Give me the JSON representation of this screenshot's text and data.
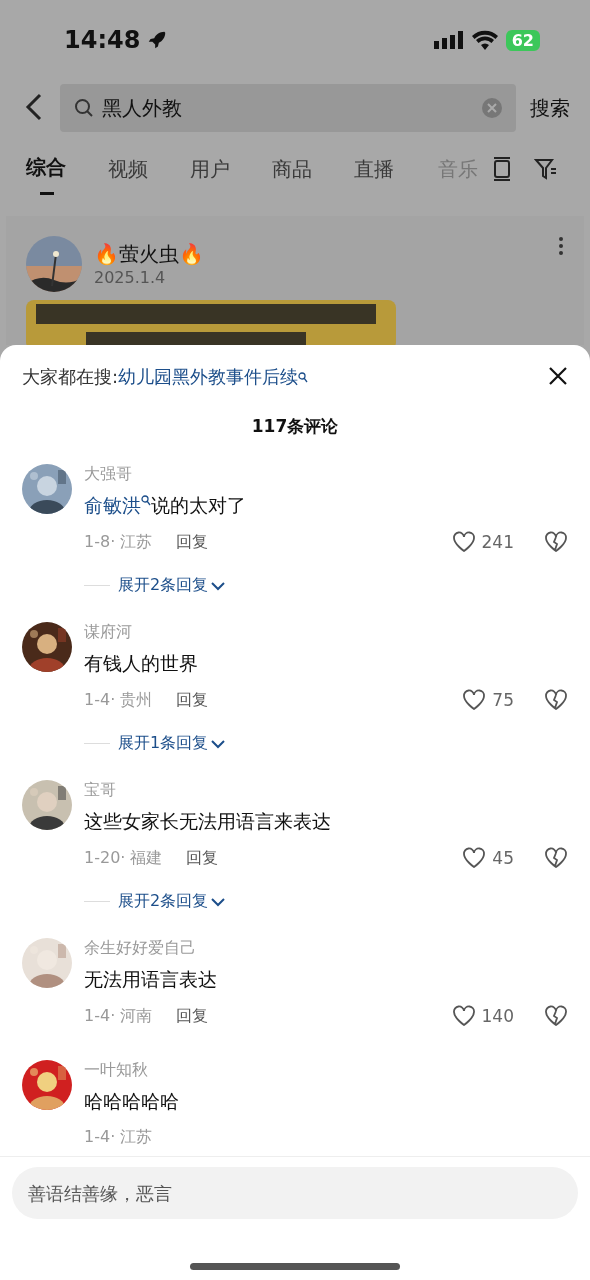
{
  "status_bar": {
    "time": "14:48",
    "battery": "62"
  },
  "search": {
    "query": "黑人外教",
    "button": "搜索"
  },
  "tabs": [
    {
      "label": "综合",
      "selected": true
    },
    {
      "label": "视频",
      "selected": false
    },
    {
      "label": "用户",
      "selected": false
    },
    {
      "label": "商品",
      "selected": false
    },
    {
      "label": "直播",
      "selected": false
    },
    {
      "label": "音乐",
      "selected": false
    }
  ],
  "post": {
    "author": "🔥萤火虫🔥",
    "date": "2025.1.4"
  },
  "comments_sheet": {
    "trending_label": "大家都在搜:",
    "trending_link": "幼儿园黑外教事件后续",
    "count": "117条评论",
    "comments": [
      {
        "user": "大强哥",
        "mention": "俞敏洪",
        "text": "说的太对了",
        "meta": "1-8· 江苏",
        "reply": "回复",
        "likes": "241",
        "expand": "展开2条回复"
      },
      {
        "user": "谋府河",
        "text": "有钱人的世界",
        "meta": "1-4· 贵州",
        "reply": "回复",
        "likes": "75",
        "expand": "展开1条回复"
      },
      {
        "user": "宝哥",
        "text": "这些女家长无法用语言来表达",
        "meta": "1-20· 福建",
        "reply": "回复",
        "likes": "45",
        "expand": "展开2条回复"
      },
      {
        "user": "余生好好爱自己",
        "text": "无法用语言表达",
        "meta": "1-4· 河南",
        "reply": "回复",
        "likes": "140"
      },
      {
        "user": "一叶知秋",
        "text": "哈哈哈哈哈",
        "meta": "1-4· 江苏"
      }
    ],
    "input": {
      "placeholder": "善语结善缘，恶言"
    }
  }
}
